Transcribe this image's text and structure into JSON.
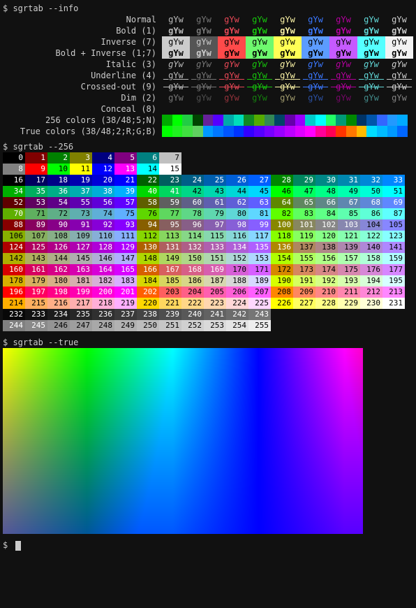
{
  "prompt": "$ ",
  "commands": {
    "info": "sgrtab --info",
    "c256": "sgrtab --256",
    "ctrue": "sgrtab --true"
  },
  "info_rows": [
    {
      "label": "Normal"
    },
    {
      "label": "Bold (1)"
    },
    {
      "label": "Inverse (7)"
    },
    {
      "label": "Bold + Inverse (1;7)"
    },
    {
      "label": "Italic (3)"
    },
    {
      "label": "Underline (4)"
    },
    {
      "label": "Crossed-out (9)"
    },
    {
      "label": "Dim (2)"
    },
    {
      "label": "Conceal (8)"
    },
    {
      "label": "256 colors (38/48;5;N)"
    },
    {
      "label": "True colors (38/48;2;R;G;B)"
    }
  ],
  "sample": "gYw",
  "ansi": {
    "fg": [
      "#bbbbbb",
      "#777777",
      "#e74856",
      "#16c60c",
      "#f9f1a5",
      "#3b78ff",
      "#b4009e",
      "#61d6d6",
      "#cccccc"
    ],
    "inv_bg": [
      "#cccccc",
      "#555555",
      "#ff4a4a",
      "#6ef96e",
      "#ffff55",
      "#5c9cff",
      "#c65aff",
      "#55ffff",
      "#f2f2f2"
    ],
    "inv_fg": [
      "#000000",
      "#cccccc",
      "#000000",
      "#000000",
      "#000000",
      "#000000",
      "#000000",
      "#000000",
      "#000000"
    ]
  },
  "bar256": [
    "#00aa00",
    "#00ff00",
    "#22cc44",
    "#004400",
    "#662299",
    "#5500ff",
    "#00aaaa",
    "#00ddbb",
    "#118822",
    "#55aa00",
    "#338855",
    "#004466",
    "#6600aa",
    "#9900ff",
    "#00cccc",
    "#00ffff",
    "#22ff66",
    "#009977",
    "#008800",
    "#003366",
    "#0055aa",
    "#3366ff",
    "#2299ff",
    "#00aaff"
  ],
  "barTrue": [
    "#00ff00",
    "#20f020",
    "#40e040",
    "#60d060",
    "#0099ff",
    "#0077ff",
    "#0055ff",
    "#0033ff",
    "#3300ff",
    "#5500ff",
    "#7700ff",
    "#9900ff",
    "#bb00ff",
    "#dd00ff",
    "#ff00ff",
    "#ff0099",
    "#ff0055",
    "#ff3300",
    "#ff7700",
    "#ffbb00",
    "#00ddff",
    "#00bbff",
    "#0099ff",
    "#0066ff"
  ],
  "xterm256": {
    "row1": [
      {
        "n": 0,
        "bg": "#000000"
      },
      {
        "n": 1,
        "bg": "#800000"
      },
      {
        "n": 2,
        "bg": "#008000"
      },
      {
        "n": 3,
        "bg": "#808000"
      },
      {
        "n": 4,
        "bg": "#000080"
      },
      {
        "n": 5,
        "bg": "#800080"
      },
      {
        "n": 6,
        "bg": "#008080"
      },
      {
        "n": 7,
        "bg": "#c0c0c0"
      }
    ],
    "row2": [
      {
        "n": 8,
        "bg": "#808080"
      },
      {
        "n": 9,
        "bg": "#ff0000"
      },
      {
        "n": 10,
        "bg": "#00ff00"
      },
      {
        "n": 11,
        "bg": "#ffff00"
      },
      {
        "n": 12,
        "bg": "#0000ff"
      },
      {
        "n": 13,
        "bg": "#ff00ff"
      },
      {
        "n": 14,
        "bg": "#00ffff"
      },
      {
        "n": 15,
        "bg": "#ffffff"
      }
    ],
    "cube_start": 16,
    "cube_end": 231,
    "gray_start": 232,
    "gray_end": 255
  }
}
